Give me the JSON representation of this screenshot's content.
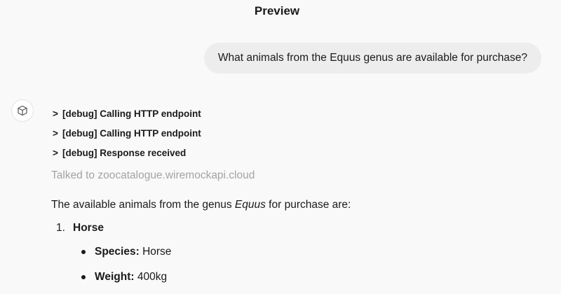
{
  "header": {
    "title": "Preview"
  },
  "conversation": {
    "user_message": "What animals from the Equus genus are available for purchase?",
    "assistant": {
      "avatar_icon": "cube-icon",
      "debug_entries": [
        {
          "chevron": ">",
          "label": "[debug] Calling HTTP endpoint"
        },
        {
          "chevron": ">",
          "label": "[debug] Calling HTTP endpoint"
        },
        {
          "chevron": ">",
          "label": "[debug] Response received"
        }
      ],
      "talked_to": "Talked to zoocatalogue.wiremockapi.cloud",
      "intro_before": "The available animals from the genus ",
      "intro_emph": "Equus",
      "intro_after": " for purchase are:",
      "items": [
        {
          "number": "1.",
          "name": "Horse",
          "details": [
            {
              "label": "Species:",
              "value": " Horse"
            },
            {
              "label": "Weight:",
              "value": " 400kg"
            }
          ]
        }
      ]
    }
  }
}
